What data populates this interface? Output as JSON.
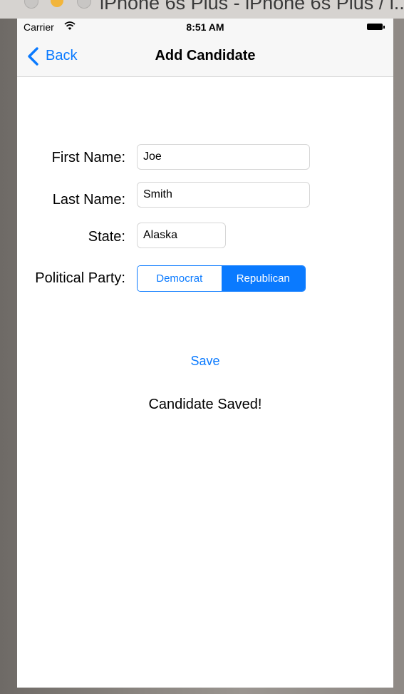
{
  "simulator": {
    "title": "iPhone 6s Plus - iPhone 6s Plus / i..."
  },
  "status_bar": {
    "carrier": "Carrier",
    "time": "8:51 AM"
  },
  "nav_bar": {
    "back_label": "Back",
    "title": "Add Candidate"
  },
  "form": {
    "first_name": {
      "label": "First Name:",
      "value": "Joe"
    },
    "last_name": {
      "label": "Last Name:",
      "value": "Smith"
    },
    "state": {
      "label": "State:",
      "value": "Alaska"
    },
    "party": {
      "label": "Political Party:",
      "options": [
        "Democrat",
        "Republican"
      ],
      "selected": "Republican"
    }
  },
  "actions": {
    "save_label": "Save"
  },
  "status_message": "Candidate Saved!",
  "colors": {
    "accent": "#0a7aff"
  },
  "icons": [
    "wifi-icon",
    "battery-icon",
    "back-chevron-icon"
  ]
}
